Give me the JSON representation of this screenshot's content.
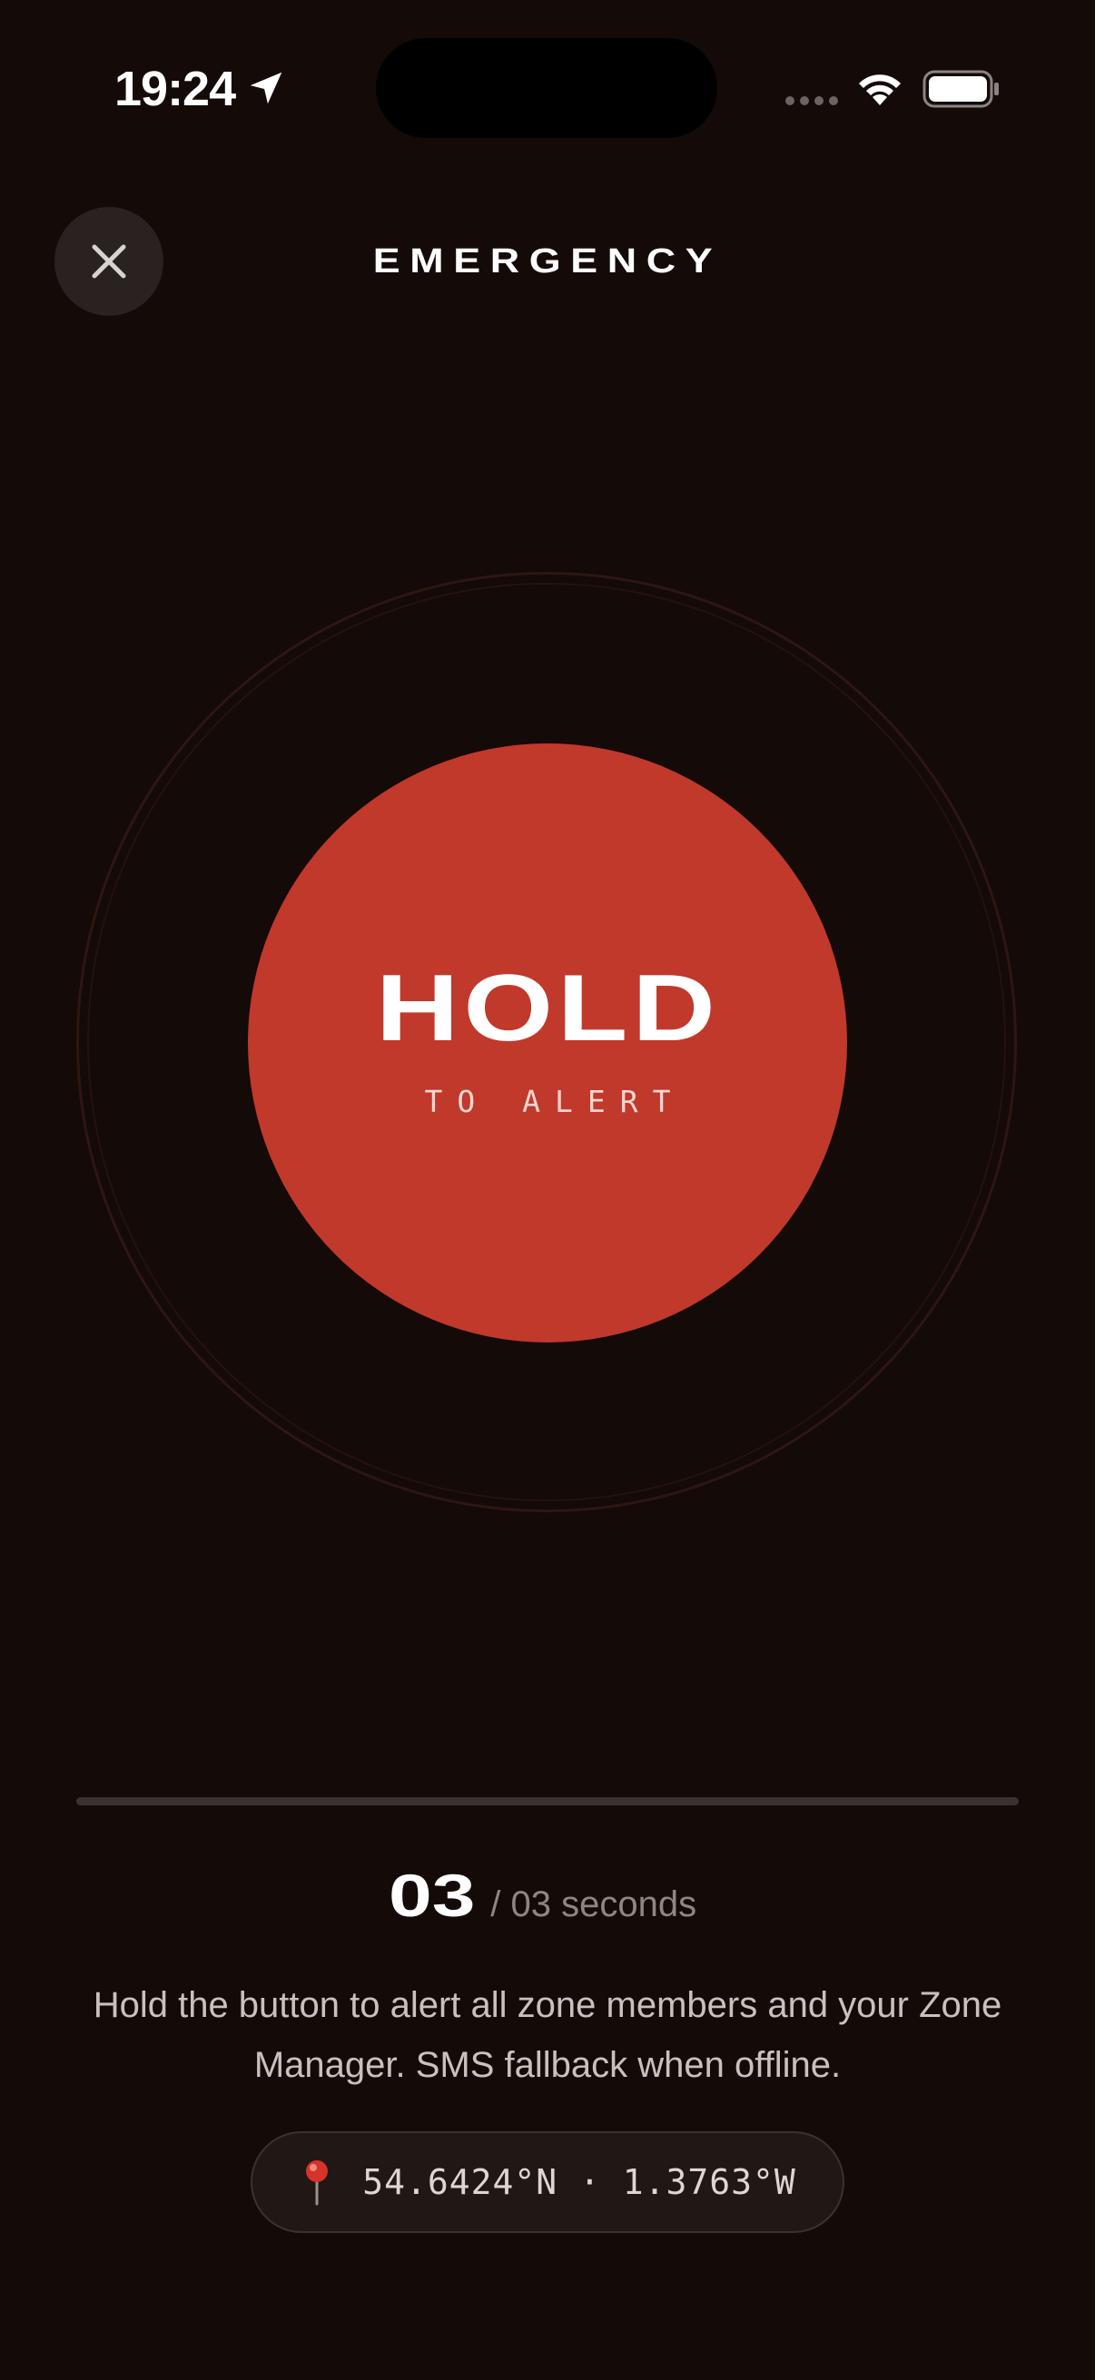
{
  "status_bar": {
    "time": "19:24",
    "icons": [
      "location-arrow-icon",
      "signal-dots-icon",
      "wifi-icon",
      "battery-icon"
    ]
  },
  "header": {
    "title": "EMERGENCY",
    "close_icon": "close-icon"
  },
  "hold_button": {
    "label": "HOLD",
    "sublabel": "TO ALERT",
    "color": "#c0392b"
  },
  "progress": {
    "fraction": 0
  },
  "countdown": {
    "value": "03",
    "total": "/ 03 seconds"
  },
  "description": "Hold the button to alert all zone members and your Zone Manager. SMS fallback when offline.",
  "location": {
    "icon": "pin-icon",
    "coordinates": "54.6424°N · 1.3763°W"
  },
  "colors": {
    "background": "#140a08",
    "accent": "#c0392b"
  }
}
